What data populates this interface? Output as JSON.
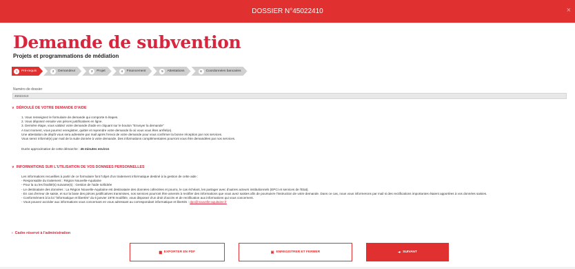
{
  "header": {
    "title": "DOSSIER N°45022410",
    "close_icon": "×"
  },
  "page": {
    "title": "Demande de subvention",
    "subtitle": "Projets et programmations de médiation"
  },
  "stepper": {
    "steps": [
      {
        "num": "1",
        "label": "Pré-requis",
        "active": true
      },
      {
        "num": "2",
        "label": "Demandeur",
        "active": false
      },
      {
        "num": "3",
        "label": "Projet",
        "active": false
      },
      {
        "num": "4",
        "label": "Financement",
        "active": false
      },
      {
        "num": "5",
        "label": "Attestations",
        "active": false
      },
      {
        "num": "6",
        "label": "Coordonnées bancaires",
        "active": false
      }
    ]
  },
  "dossier": {
    "label": "Numéro de dossier",
    "value": "45022410"
  },
  "section1": {
    "title": "DÉROULÉ DE VOTRE DEMANDE D'AIDE",
    "lines": [
      "1. Vous renseignez le formulaire de demande qui comporte 6 étapes.",
      "2. Vous déposez ensuite vos pièces justificatives en ligne.",
      "3. Dernière étape, vous validez votre demande d'aide en cliquant sur le bouton \"Envoyer la demande\"",
      "A tout moment, vous pourrez enregistrer, quitter et reprendre votre demande là où vous vous êtes arrêté(e).",
      "Une attestation de dépôt vous sera adressée par mail après l'envoi de votre demande pour vous confirmer la bonne réception par nos services.",
      "Vous serez informé(e) par mail de la suite donnée à votre demande. Des informations complémentaires pourront vous être demandées par nos services."
    ],
    "duration_label": "Durée approximative de cette démarche :",
    "duration_value": "45 minutes environ"
  },
  "section2": {
    "title": "INFORMATIONS SUR L'UTILISATION DE VOS DONNEES PERSONNELLES",
    "intro": "Les informations recueillies à partir de ce formulaire font l'objet d'un traitement informatique destiné à la gestion de cette aide :",
    "lines": [
      "- Responsable du traitement : Région Nouvelle-Aquitaine",
      "- Pour la ou les finalité(s) suivante(s) : Gestion de l'aide sollicitée",
      "- Le destinataire des données : La Région Nouvelle-Aquitaine est destinataire des données collectées et pourra, le cas échéant, les partager avec d'autres acteurs institutionnels (EPCI et services de l'Etat).",
      "- En cas d'erreur de saisie, et sur la base des pièces justificatives transmises, nos services pourront être amenés à rectifier des informations que vous avez saisies afin de poursuivre l'instruction de votre demande. Dans ce cas, nous vous informerons par mail si des rectifications importantes étaient apportées à vos données saisies.",
      "- Conformément à la loi \"informatique et libertés\" du 6 janvier 1978 modifiée, vous disposez d'un droit d'accès et de rectification aux informations qui vous concernent.",
      "- Vous pouvez accéder aux informations vous concernant en vous adressant au correspondant informatique et libertés :"
    ],
    "email": "dpo@nouvelle-aquitaine.fr"
  },
  "section3": {
    "title": "Cadre réservé à l'administration"
  },
  "buttons": {
    "export": "EXPORTER EN PDF",
    "save": "ENREGISTRER ET FERMER",
    "next": "SUIVANT"
  },
  "colors": {
    "accent": "#e0302f",
    "title": "#d7263d"
  }
}
